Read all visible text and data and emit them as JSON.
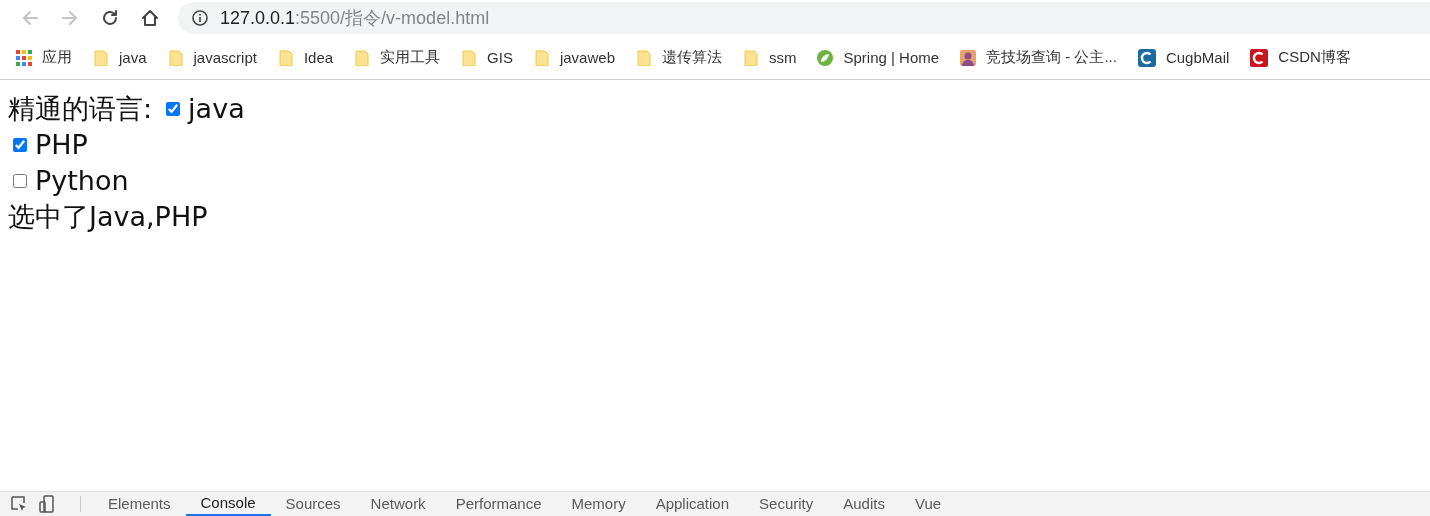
{
  "toolbar": {
    "url": {
      "host": "127.0.0.1",
      "path": ":5500/指令/v-model.html"
    }
  },
  "bookmarks": [
    {
      "kind": "apps",
      "label": "应用"
    },
    {
      "kind": "folder",
      "label": "java"
    },
    {
      "kind": "folder",
      "label": "javascript"
    },
    {
      "kind": "folder",
      "label": "Idea"
    },
    {
      "kind": "folder",
      "label": "实用工具"
    },
    {
      "kind": "folder",
      "label": "GIS"
    },
    {
      "kind": "folder",
      "label": "javaweb"
    },
    {
      "kind": "folder",
      "label": "遗传算法"
    },
    {
      "kind": "folder",
      "label": "ssm"
    },
    {
      "kind": "leaf",
      "label": "Spring | Home"
    },
    {
      "kind": "avatar",
      "label": "竞技场查询 - 公主..."
    },
    {
      "kind": "mail",
      "label": "CugbMail"
    },
    {
      "kind": "blog",
      "label": "CSDN博客"
    }
  ],
  "page": {
    "prompt": "精通的语言:",
    "options": [
      {
        "label": "java",
        "checked": true
      },
      {
        "label": "PHP",
        "checked": true
      },
      {
        "label": "Python",
        "checked": false
      }
    ],
    "result": "选中了Java,PHP"
  },
  "devtools": {
    "tabs": [
      {
        "label": "Elements",
        "selected": false
      },
      {
        "label": "Console",
        "selected": true
      },
      {
        "label": "Sources",
        "selected": false
      },
      {
        "label": "Network",
        "selected": false
      },
      {
        "label": "Performance",
        "selected": false
      },
      {
        "label": "Memory",
        "selected": false
      },
      {
        "label": "Application",
        "selected": false
      },
      {
        "label": "Security",
        "selected": false
      },
      {
        "label": "Audits",
        "selected": false
      },
      {
        "label": "Vue",
        "selected": false
      }
    ]
  }
}
